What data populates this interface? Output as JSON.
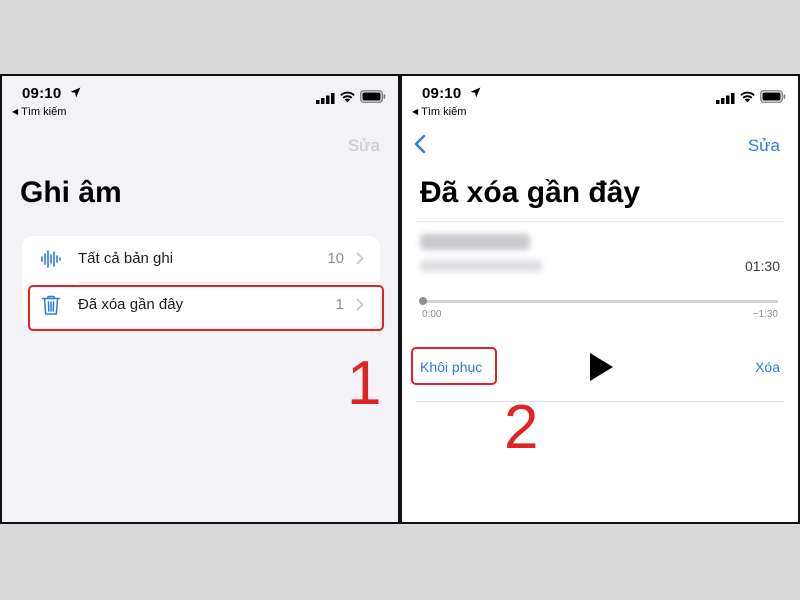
{
  "left_screen": {
    "status": {
      "time": "09:10",
      "back_app": "Tìm kiếm"
    },
    "nav": {
      "edit_label": "Sửa"
    },
    "title": "Ghi âm",
    "list": [
      {
        "label": "Tất cả bản ghi",
        "count": "10",
        "icon": "waveform-icon"
      },
      {
        "label": "Đã xóa gần đây",
        "count": "1",
        "icon": "trash-icon"
      }
    ],
    "step_number": "1"
  },
  "right_screen": {
    "status": {
      "time": "09:10",
      "back_app": "Tìm kiếm"
    },
    "nav": {
      "edit_label": "Sửa"
    },
    "title": "Đã xóa gần đây",
    "recording": {
      "duration": "01:30",
      "elapsed": "0:00",
      "remaining": "−1:30",
      "progress": 0
    },
    "actions": {
      "recover_label": "Khôi phục",
      "delete_label": "Xóa"
    },
    "step_number": "2"
  },
  "colors": {
    "accent": "#2c7be5",
    "annotation_red": "#e02424",
    "disabled": "#c7c7cc",
    "background_grouped": "#f2f2f7"
  }
}
